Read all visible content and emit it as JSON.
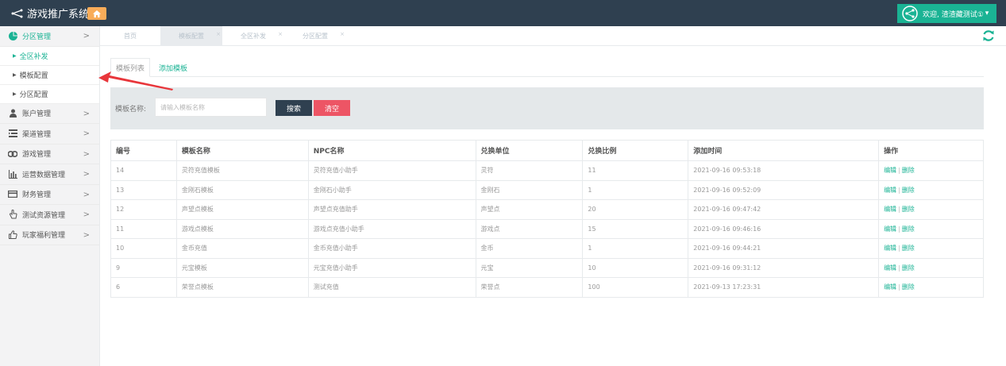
{
  "app": {
    "title": "游戏推广系统"
  },
  "user": {
    "greeting": "欢迎, 渣渣藏测试①",
    "caret": "▾"
  },
  "sidebar": {
    "items": [
      {
        "label": "分区管理",
        "icon": "pie-chart-icon",
        "expanded": true,
        "children": [
          {
            "label": "全区补发",
            "active": true
          },
          {
            "label": "模板配置"
          },
          {
            "label": "分区配置"
          }
        ]
      },
      {
        "label": "账户管理",
        "icon": "user-icon"
      },
      {
        "label": "渠道管理",
        "icon": "list-icon"
      },
      {
        "label": "游戏管理",
        "icon": "gamepad-icon"
      },
      {
        "label": "运营数据管理",
        "icon": "bar-chart-icon"
      },
      {
        "label": "财务管理",
        "icon": "wallet-icon"
      },
      {
        "label": "测试资源管理",
        "icon": "hand-pointer-icon"
      },
      {
        "label": "玩家福利管理",
        "icon": "thumbs-up-icon"
      }
    ],
    "chevron": ">"
  },
  "tabs": [
    {
      "label": "首页",
      "closable": false
    },
    {
      "label": "模板配置",
      "closable": true,
      "active": true
    },
    {
      "label": "全区补发",
      "closable": true
    },
    {
      "label": "分区配置",
      "closable": true
    }
  ],
  "tab_close_glyph": "×",
  "subtabs": [
    {
      "label": "模板列表",
      "active": true
    },
    {
      "label": "添加模板"
    }
  ],
  "search": {
    "label": "模板名称:",
    "placeholder": "请输入模板名称",
    "search_button": "搜索",
    "clear_button": "清空"
  },
  "table": {
    "headers": [
      "编号",
      "模板名称",
      "NPC名称",
      "兑换单位",
      "兑换比例",
      "添加时间",
      "操作"
    ],
    "rows": [
      [
        "14",
        "灵符充值模板",
        "灵符充值小助手",
        "灵符",
        "11",
        "2021-09-16 09:53:18"
      ],
      [
        "13",
        "金刚石模板",
        "金刚石小助手",
        "金刚石",
        "1",
        "2021-09-16 09:52:09"
      ],
      [
        "12",
        "声望点模板",
        "声望点充值助手",
        "声望点",
        "20",
        "2021-09-16 09:47:42"
      ],
      [
        "11",
        "游戏点模板",
        "游戏点充值小助手",
        "游戏点",
        "15",
        "2021-09-16 09:46:16"
      ],
      [
        "10",
        "金币充值",
        "金币充值小助手",
        "金币",
        "1",
        "2021-09-16 09:44:21"
      ],
      [
        "9",
        "元宝模板",
        "元宝充值小助手",
        "元宝",
        "10",
        "2021-09-16 09:31:12"
      ],
      [
        "6",
        "荣誉点模板",
        "测试充值",
        "荣誉点",
        "100",
        "2021-09-13 17:23:31"
      ]
    ],
    "actions": {
      "edit": "编辑",
      "separator": "|",
      "delete": "删除"
    }
  },
  "colors": {
    "topbar": "#2f4050",
    "accent": "#1ab394",
    "danger": "#ed5565",
    "home": "#f8ac59",
    "annotation_arrow": "#e8363b"
  }
}
